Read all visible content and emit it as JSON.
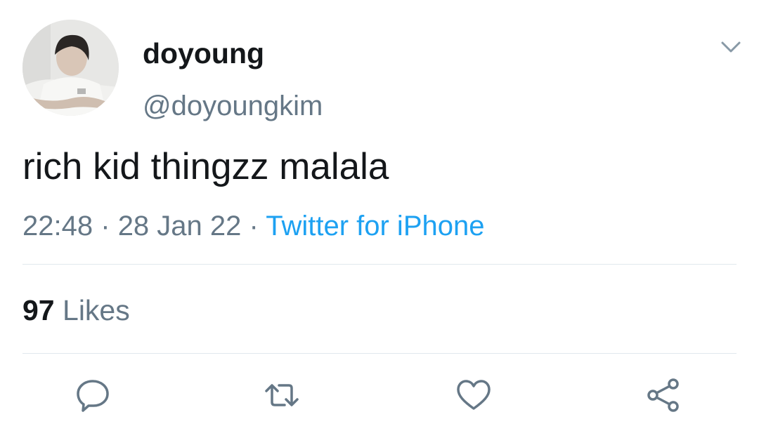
{
  "user": {
    "display_name": "doyoung",
    "handle": "@doyoungkim"
  },
  "tweet": {
    "text": "rich kid thingzz malala",
    "time": "22:48",
    "separator": "·",
    "date": "28 Jan 22",
    "source": "Twitter for iPhone"
  },
  "stats": {
    "likes_count": "97",
    "likes_label": "Likes"
  },
  "icons": {
    "menu": "chevron-down-icon",
    "reply": "reply-icon",
    "retweet": "retweet-icon",
    "like": "heart-icon",
    "share": "share-icon"
  },
  "colors": {
    "text": "#14171a",
    "secondary": "#657786",
    "link": "#1da1f2",
    "divider": "#e1e8ed"
  }
}
